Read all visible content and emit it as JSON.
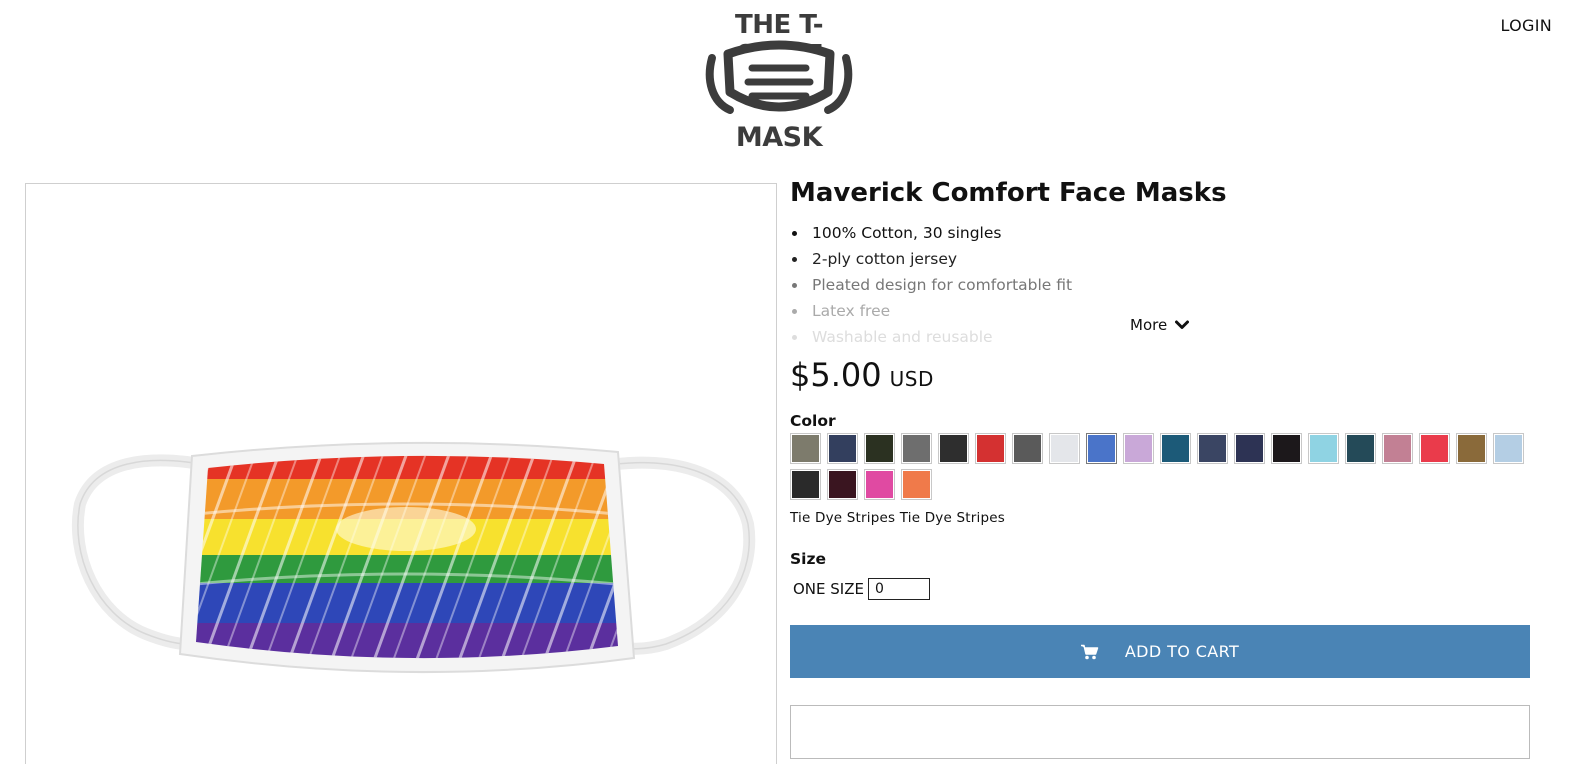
{
  "header": {
    "logo_line1": "THE T-SHIRT",
    "logo_line2": "MASK",
    "login_label": "LOGIN"
  },
  "product": {
    "title": "Maverick Comfort Face Masks",
    "features": [
      "100% Cotton, 30 singles",
      "2-ply cotton jersey",
      "Pleated design for comfortable fit",
      "Latex free",
      "Washable and reusable"
    ],
    "more_label": "More",
    "price": "$5.00",
    "currency": "USD",
    "color_label": "Color",
    "colors": [
      {
        "name": "olive",
        "color": "#7d7b6c"
      },
      {
        "name": "navy",
        "color": "#333f5e"
      },
      {
        "name": "army-camo",
        "color": "#2b3121"
      },
      {
        "name": "grey",
        "color": "#6e6e6e"
      },
      {
        "name": "black-camo",
        "color": "#2e2e2e"
      },
      {
        "name": "canada-flag",
        "color": "#d43131"
      },
      {
        "name": "grey-texture",
        "color": "#5a5a5a"
      },
      {
        "name": "white",
        "color": "#e4e6ea"
      },
      {
        "name": "tie-dye-stripes",
        "color": "#4a74c9"
      },
      {
        "name": "pastel-tie-dye",
        "color": "#c9a8d8"
      },
      {
        "name": "teal",
        "color": "#1c5a78"
      },
      {
        "name": "navy-stripe",
        "color": "#3a4563"
      },
      {
        "name": "usa-flag",
        "color": "#2d3354"
      },
      {
        "name": "black",
        "color": "#1c181b"
      },
      {
        "name": "light-blue-tie-dye",
        "color": "#8fd3e3"
      },
      {
        "name": "dark-teal-pattern",
        "color": "#244a58"
      },
      {
        "name": "mauve",
        "color": "#c28094"
      },
      {
        "name": "red",
        "color": "#ea3b4b"
      },
      {
        "name": "leopard",
        "color": "#8a6a3a"
      },
      {
        "name": "light-blue",
        "color": "#b4cee4"
      },
      {
        "name": "black-marble",
        "color": "#2a2a2a"
      },
      {
        "name": "burgundy-camo",
        "color": "#3a1520"
      },
      {
        "name": "rainbow-pink",
        "color": "#e04aa2"
      },
      {
        "name": "sunset",
        "color": "#f07a4a"
      }
    ],
    "selected_color_text": "Tie Dye Stripes Tie Dye Stripes",
    "size_label": "Size",
    "size_option": "ONE SIZE",
    "quantity": "0",
    "add_to_cart_label": "ADD TO CART"
  }
}
